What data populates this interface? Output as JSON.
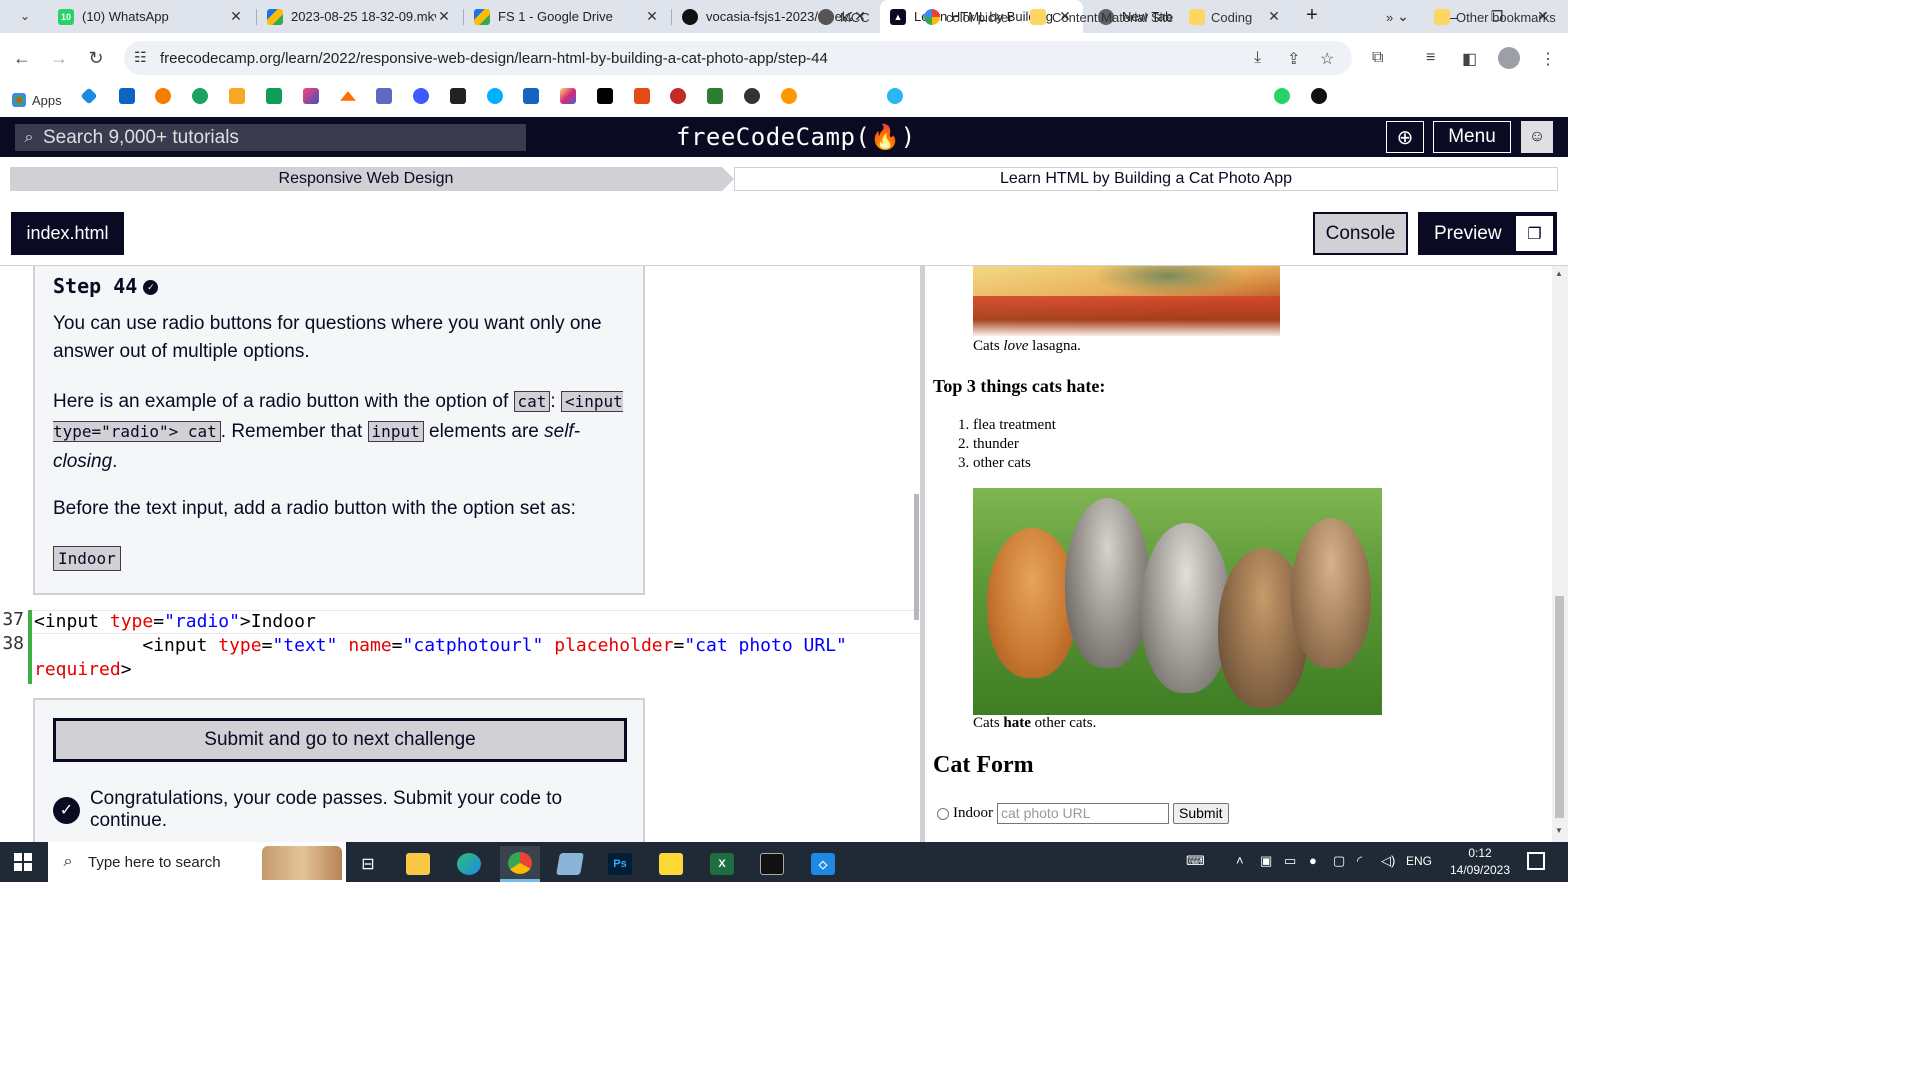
{
  "browser": {
    "tabs": [
      {
        "title": "(10) WhatsApp",
        "favicon_color": "#25d366",
        "badge": "10",
        "active": false
      },
      {
        "title": "2023-08-25 18-32-09.mkv",
        "favicon_color": "#1a73e8",
        "active": false
      },
      {
        "title": "FS 1 - Google Drive",
        "favicon_color": "#1a73e8",
        "active": false
      },
      {
        "title": "vocasia-fsjs1-2023/week2",
        "favicon_color": "#111111",
        "active": false
      },
      {
        "title": "Learn HTML by Building a",
        "favicon_color": "#0a0a23",
        "active": true
      },
      {
        "title": "New Tab",
        "favicon_color": "#555555",
        "active": false
      }
    ],
    "url": "freecodecamp.org/learn/2022/responsive-web-design/learn-html-by-building-a-cat-photo-app/step-44",
    "bookmarks": {
      "apps_label": "Apps",
      "mcc": "MCC",
      "color_picker": "color picker",
      "content_material": "Content.Material Site",
      "coding": "Coding",
      "other": "Other bookmarks",
      "overflow": "»"
    }
  },
  "fcc": {
    "search_placeholder": "Search 9,000+ tutorials",
    "logo": "freeCodeCamp(🔥)",
    "menu_label": "Menu",
    "breadcrumb": {
      "course": "Responsive Web Design",
      "project": "Learn HTML by Building a Cat Photo App"
    },
    "file_tab": "index.html",
    "console_label": "Console",
    "preview_label": "Preview"
  },
  "instructions": {
    "step_title": "Step 44",
    "p1": "You can use radio buttons for questions where you want only one answer out of multiple options.",
    "p2_a": "Here is an example of a radio button with the option of ",
    "p2_code1": "cat",
    "p2_b": ": ",
    "p2_code2": "<input type=\"radio\"> cat",
    "p2_c": ". Remember that ",
    "p2_code3": "input",
    "p2_d": " elements are ",
    "p2_em": "self-closing",
    "p2_e": ".",
    "p3": "Before the text input, add a radio button with the option set as:",
    "answer": "Indoor"
  },
  "code_editor": {
    "line_numbers": [
      "37",
      "38"
    ],
    "line1": {
      "open": "<input ",
      "attr": "type",
      "eq": "=",
      "val": "\"radio\"",
      "close": ">Indoor"
    },
    "line2": {
      "indent": "          ",
      "open": "<input ",
      "attr1": "type",
      "val1": "\"text\"",
      "attr2": "name",
      "val2": "\"catphotourl\"",
      "attr3": "placeholder",
      "val3": "\"cat photo URL\"",
      "wrap_attr": "required",
      "close": ">"
    }
  },
  "actions": {
    "submit_label": "Submit and go to next challenge",
    "congrats": "Congratulations, your code passes. Submit your code to continue."
  },
  "preview": {
    "caption1_pre": "Cats ",
    "caption1_em": "love",
    "caption1_post": " lasagna.",
    "hate_heading": "Top 3 things cats hate:",
    "hate_items": [
      "flea treatment",
      "thunder",
      "other cats"
    ],
    "caption2_pre": "Cats ",
    "caption2_strong": "hate",
    "caption2_post": " other cats.",
    "form_heading": "Cat Form",
    "radio_label": "Indoor",
    "text_placeholder": "cat photo URL",
    "submit": "Submit"
  },
  "taskbar": {
    "search_placeholder": "Type here to search",
    "lang": "ENG",
    "time": "0:12",
    "date": "14/09/2023"
  }
}
